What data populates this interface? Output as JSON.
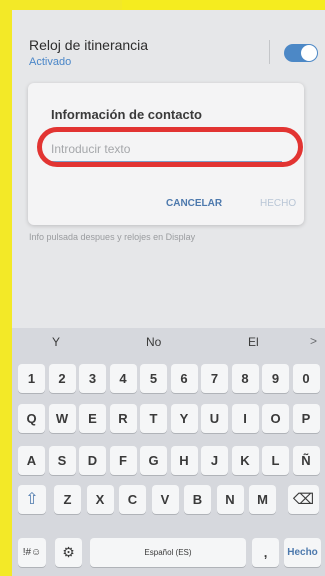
{
  "settings": {
    "title": "Reloj de itinerancia",
    "status": "Activado",
    "blurred_text": "Info pulsada despues y relojes en Display",
    "toggle_on": true
  },
  "dialog": {
    "title": "Información de contacto",
    "placeholder": "Introducir texto",
    "cancel_label": "CANCELAR",
    "done_label": "HECHO"
  },
  "keyboard": {
    "suggestions": [
      "Y",
      "No",
      "El"
    ],
    "suggestion_more": ">",
    "row_numbers": [
      "1",
      "2",
      "3",
      "4",
      "5",
      "6",
      "7",
      "8",
      "9",
      "0"
    ],
    "row_1": [
      "Q",
      "W",
      "E",
      "R",
      "T",
      "Y",
      "U",
      "I",
      "O",
      "P"
    ],
    "row_2": [
      "A",
      "S",
      "D",
      "F",
      "G",
      "H",
      "J",
      "K",
      "L",
      "Ñ"
    ],
    "row_3": [
      "Z",
      "X",
      "C",
      "V",
      "B",
      "N",
      "M"
    ],
    "shift_glyph": "⇧",
    "backspace_glyph": "⌫",
    "symbols_label": "!#☺",
    "settings_glyph": "⚙",
    "space_label": "Español (ES)",
    "comma_label": ",",
    "enter_label": "Hecho"
  },
  "colors": {
    "accent": "#4d79ad",
    "highlight_ring": "#e23432",
    "frame": "#f3e927"
  }
}
